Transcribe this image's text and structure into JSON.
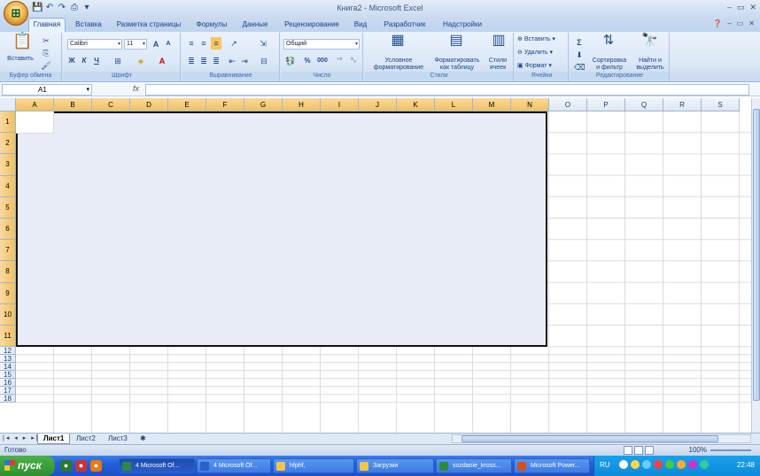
{
  "window": {
    "title": "Книга2 - Microsoft Excel",
    "min": "–",
    "max": "▭",
    "close": "✕"
  },
  "qat": [
    "💾",
    "↶",
    "↷",
    "⎙",
    "▾"
  ],
  "tabs": [
    "Главная",
    "Вставка",
    "Разметка страницы",
    "Формулы",
    "Данные",
    "Рецензирование",
    "Вид",
    "Разработчик",
    "Надстройки"
  ],
  "ribbon": {
    "clipboard": {
      "paste": "Вставить",
      "label": "Буфер обмена"
    },
    "font": {
      "name": "Calibri",
      "size": "11",
      "bold": "Ж",
      "italic": "К",
      "underline": "Ч",
      "label": "Шрифт"
    },
    "alignment": {
      "label": "Выравнивание"
    },
    "number": {
      "format": "Общий",
      "percent": "%",
      "thousands": "000",
      "label": "Число"
    },
    "styles": {
      "conditional": "Условное форматирование",
      "table": "Форматировать как таблицу",
      "cell": "Стили ячеек",
      "label": "Стили"
    },
    "cells": {
      "insert": "Вставить",
      "delete": "Удалить",
      "format": "Формат",
      "label": "Ячейки"
    },
    "editing": {
      "sort": "Сортировка и фильтр",
      "find": "Найти и выделить",
      "label": "Редактирование"
    }
  },
  "formula_bar": {
    "name_box": "A1",
    "fx": "fx",
    "value": ""
  },
  "columns": [
    "A",
    "B",
    "C",
    "D",
    "E",
    "F",
    "G",
    "H",
    "I",
    "J",
    "K",
    "L",
    "M",
    "N",
    "O",
    "P",
    "Q",
    "R",
    "S"
  ],
  "rows": [
    "1",
    "2",
    "3",
    "4",
    "5",
    "6",
    "7",
    "8",
    "9",
    "10",
    "11",
    "12",
    "13",
    "14",
    "15",
    "16",
    "17",
    "18"
  ],
  "sheets": [
    "Лист1",
    "Лист2",
    "Лист3"
  ],
  "status": {
    "text": "Готово",
    "zoom": "100%"
  },
  "taskbar": {
    "start": "пуск",
    "buttons": [
      "4 Microsoft Of...",
      "4 Microsoft Of...",
      "hfphf,",
      "Загрузки",
      "sozdanie_kross...",
      "Microsoft Power..."
    ],
    "lang": "RU",
    "clock": "22:48"
  }
}
